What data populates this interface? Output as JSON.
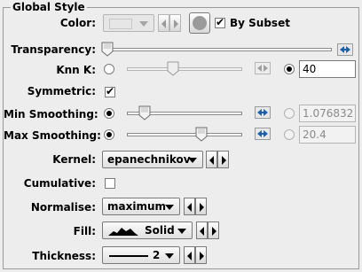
{
  "panel": {
    "title": "Global Style"
  },
  "color": {
    "label": "Color:",
    "by_subset_label": "By Subset",
    "by_subset_checked": true
  },
  "transparency": {
    "label": "Transparency:",
    "value": 0.0
  },
  "knn": {
    "label": "Knn K:",
    "value": "40",
    "slider_level": 0.4,
    "selected": "value"
  },
  "symmetric": {
    "label": "Symmetric:",
    "checked": true
  },
  "min_smoothing": {
    "label": "Min Smoothing:",
    "value": "1.076832",
    "slider_level": 0.1,
    "selected": "slider"
  },
  "max_smoothing": {
    "label": "Max Smoothing:",
    "value": "20.4",
    "slider_level": 0.65,
    "selected": "slider"
  },
  "kernel": {
    "label": "Kernel:",
    "value": "epanechnikov"
  },
  "cumulative": {
    "label": "Cumulative:",
    "checked": false
  },
  "normalise": {
    "label": "Normalise:",
    "value": "maximum"
  },
  "fill": {
    "label": "Fill:",
    "value": "Solid"
  },
  "thickness": {
    "label": "Thickness:",
    "value": "2"
  },
  "colors": {
    "panel_bg": "#ededed",
    "border": "#9a9a9a",
    "disabled_text": "#8a8a8a",
    "icon_blue": "#1f5fa8"
  },
  "icons": {
    "thumb": "slider-thumb-icon",
    "reset": "reset-arrows-icon"
  }
}
